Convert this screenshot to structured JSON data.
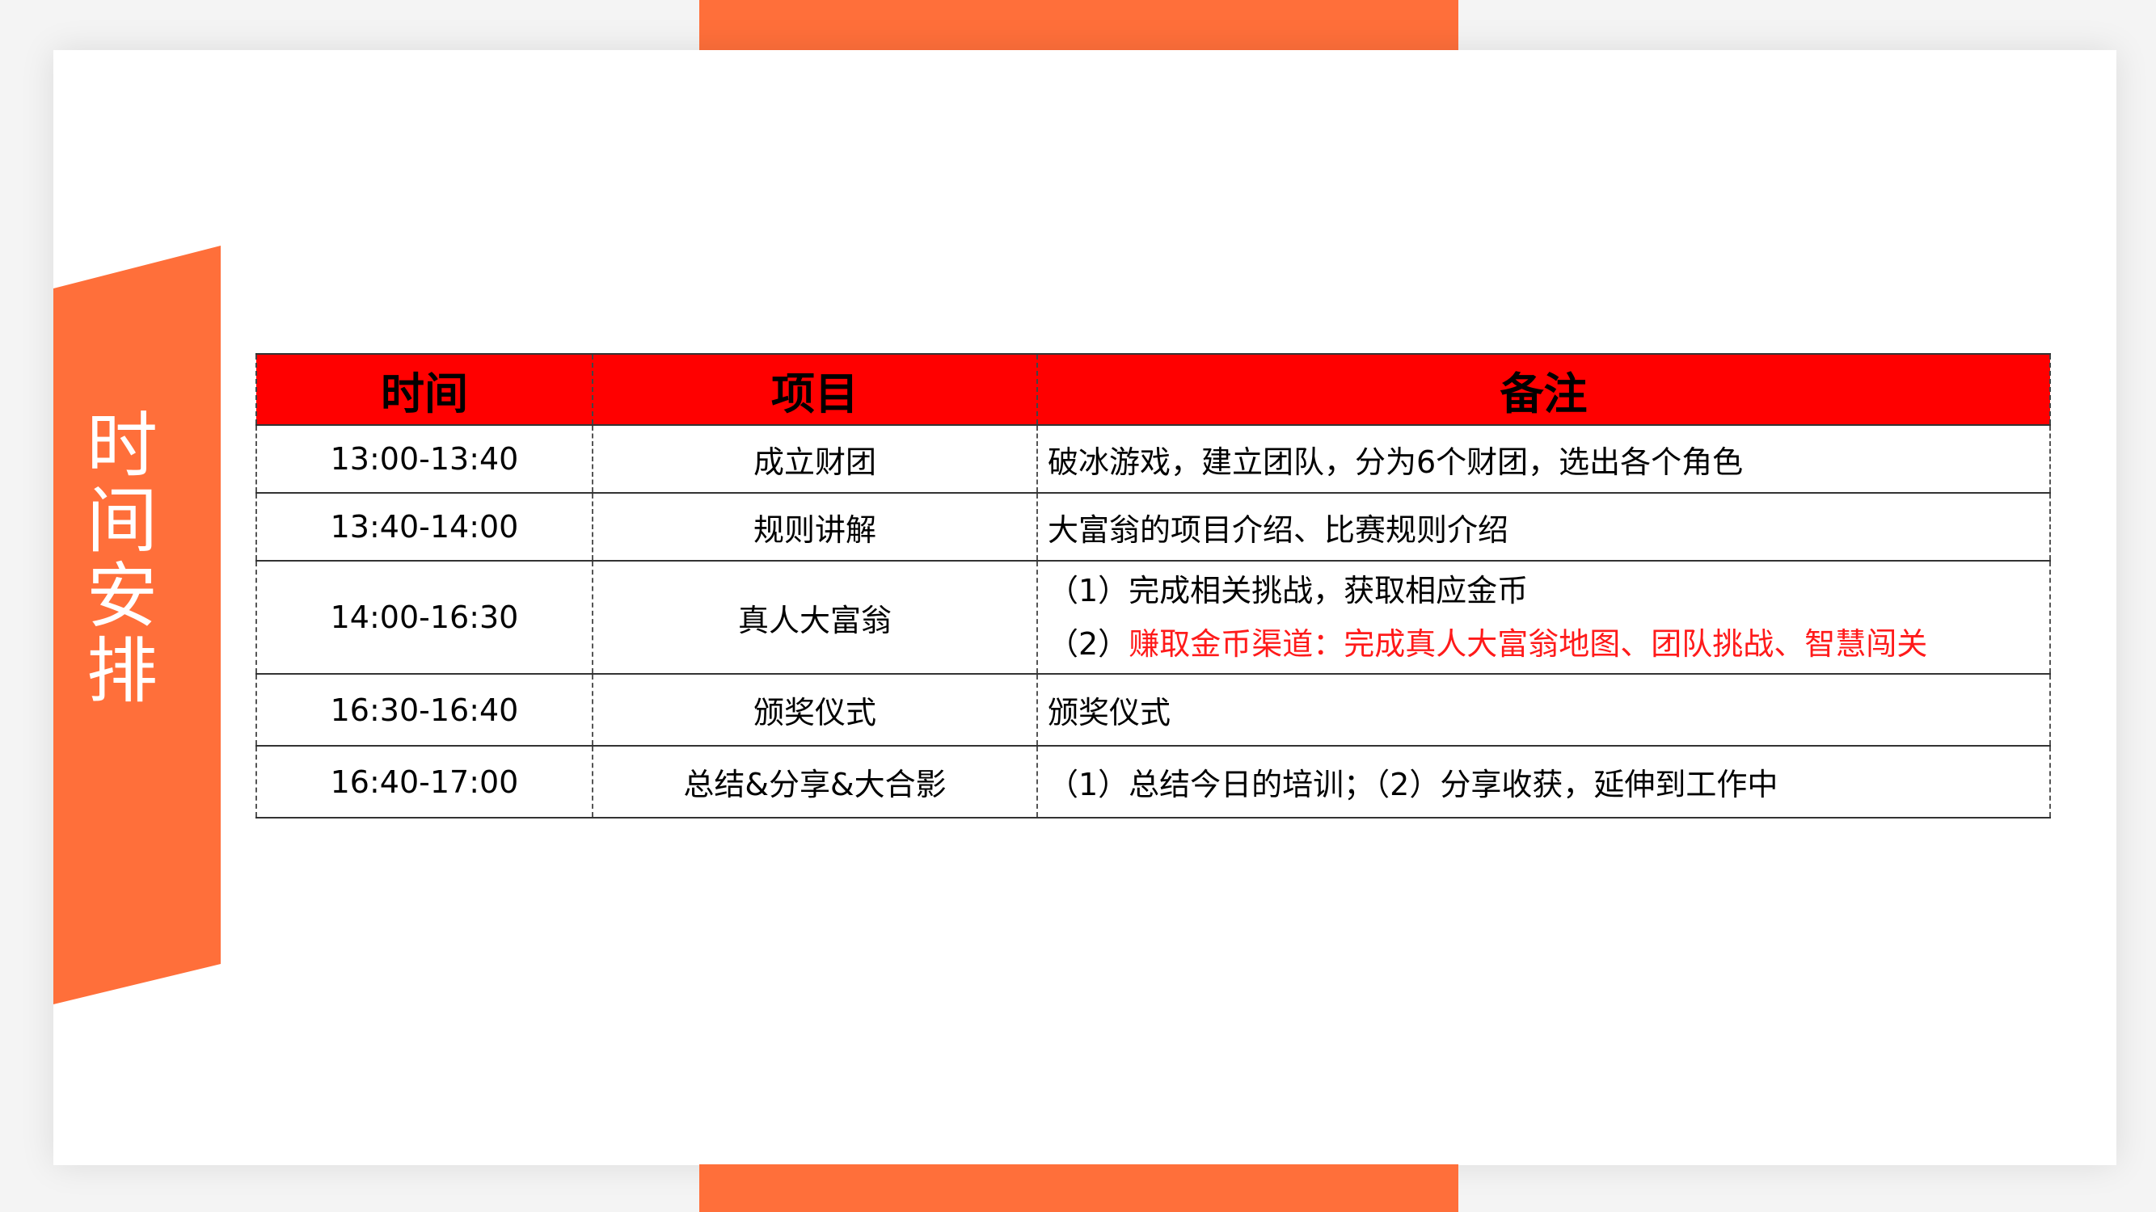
{
  "side_title": "时间安排",
  "table": {
    "headers": [
      "时间",
      "项目",
      "备注"
    ],
    "rows": [
      {
        "time": "13:00-13:40",
        "item": "成立财团",
        "notes": [
          "破冰游戏，建立团队，分为6个财团，选出各个角色"
        ]
      },
      {
        "time": "13:40-14:00",
        "item": "规则讲解",
        "notes": [
          " 大富翁的项目介绍、比赛规则介绍"
        ]
      },
      {
        "time": "14:00-16:30",
        "item": "真人大富翁",
        "notes": [
          " （1）完成相关挑战，获取相应金币"
        ],
        "note_2_prefix": " （2）",
        "note_2_highlight": "赚取金币渠道：完成真人大富翁地图、团队挑战、智慧闯关"
      },
      {
        "time": "16:30-16:40",
        "item": "颁奖仪式",
        "notes": [
          "颁奖仪式"
        ]
      },
      {
        "time": "16:40-17:00",
        "item": "总结&分享&大合影",
        "notes": [
          " （1）总结今日的培训；（2）分享收获，延伸到工作中"
        ]
      }
    ]
  },
  "colors": {
    "accent": "#ff6f3a",
    "header": "#ff0000",
    "highlight_text": "#ff1a1a"
  }
}
